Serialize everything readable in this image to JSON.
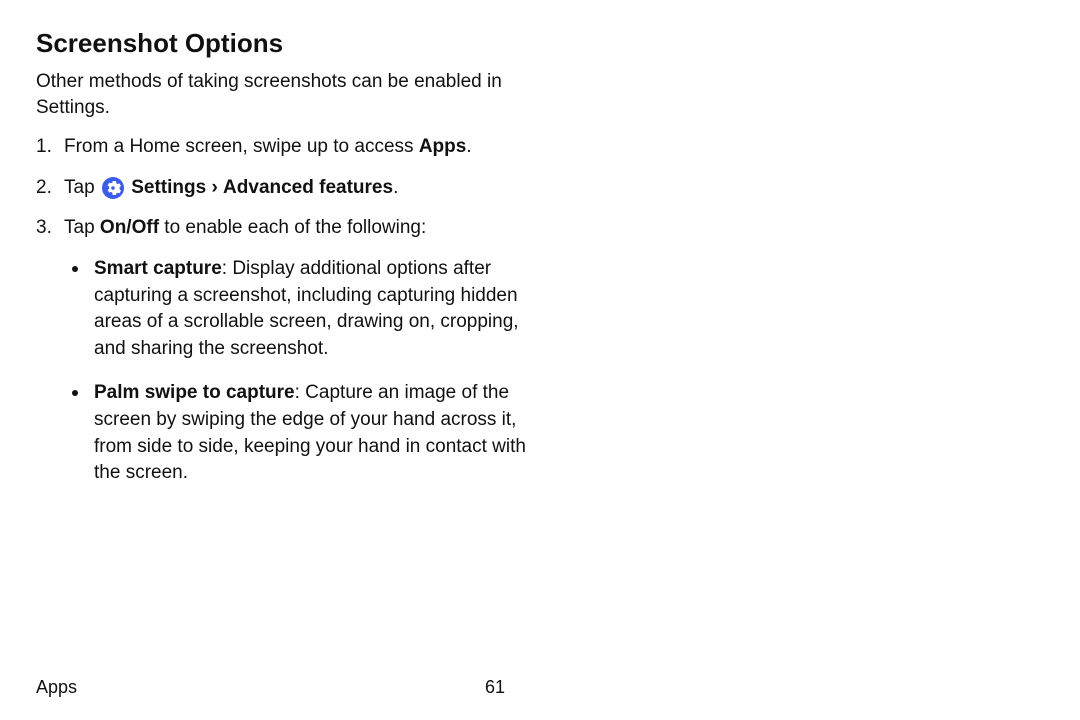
{
  "heading": "Screenshot Options",
  "intro": "Other methods of taking screenshots can be enabled in Settings.",
  "steps": {
    "s1": {
      "pre": "From a Home screen, swipe up to access ",
      "bold": "Apps",
      "post": "."
    },
    "s2": {
      "pre": "Tap ",
      "settings_label": "Settings",
      "caret": "›",
      "after": "Advanced features",
      "post": "."
    },
    "s3": {
      "pre": "Tap ",
      "bold": "On/Off",
      "post": " to enable each of the following:"
    }
  },
  "bullets": {
    "b1": {
      "title": "Smart capture",
      "desc": ": Display additional options after capturing a screenshot, including capturing hidden areas of a scrollable screen, drawing on, cropping, and sharing the screenshot."
    },
    "b2": {
      "title": "Palm swipe to capture",
      "desc": ": Capture an image of the screen by swiping the edge of your hand across it, from side to side, keeping your hand in contact with the screen."
    }
  },
  "footer": {
    "section": "Apps",
    "page": "61"
  },
  "colors": {
    "accent": "#3A5CF0"
  }
}
